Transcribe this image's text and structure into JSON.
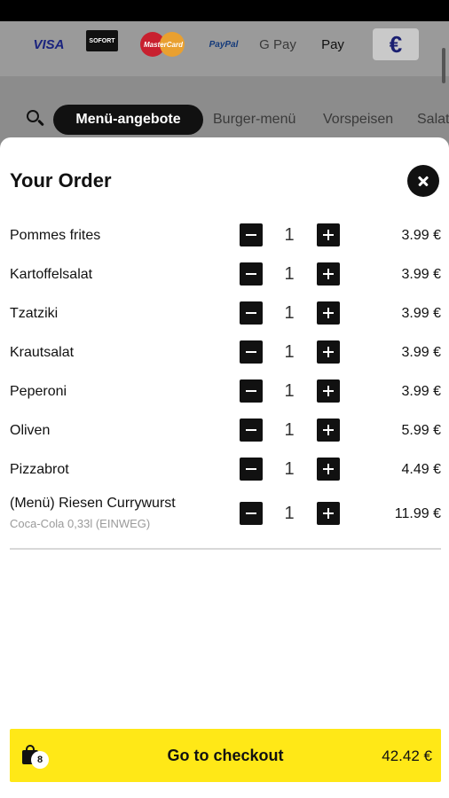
{
  "payment_methods": {
    "visa": "VISA",
    "sofort": "SOFORT",
    "mastercard": "MasterCard",
    "paypal": "PayPal",
    "gpay": "G Pay",
    "applepay": " Pay",
    "euro": "€"
  },
  "nav": {
    "tabs": [
      {
        "label": "Menü-angebote",
        "active": true
      },
      {
        "label": "Burger-menü",
        "active": false
      },
      {
        "label": "Vorspeisen",
        "active": false
      },
      {
        "label": "Salat",
        "active": false
      }
    ]
  },
  "order": {
    "title": "Your Order",
    "items": [
      {
        "name": "Pommes frites",
        "qty": "1",
        "price": "3.99 €"
      },
      {
        "name": "Kartoffelsalat",
        "qty": "1",
        "price": "3.99 €"
      },
      {
        "name": "Tzatziki",
        "qty": "1",
        "price": "3.99 €"
      },
      {
        "name": "Krautsalat",
        "qty": "1",
        "price": "3.99 €"
      },
      {
        "name": "Peperoni",
        "qty": "1",
        "price": "3.99 €"
      },
      {
        "name": "Oliven",
        "qty": "1",
        "price": "5.99 €"
      },
      {
        "name": "Pizzabrot",
        "qty": "1",
        "price": "4.49 €"
      },
      {
        "name": "(Menü) Riesen Currywurst",
        "sub": "Coca-Cola 0,33l (EINWEG)",
        "qty": "1",
        "price": "11.99 €"
      }
    ]
  },
  "checkout": {
    "count": "8",
    "label": "Go to checkout",
    "total": "42.42 €"
  },
  "colors": {
    "accent": "#ffe817",
    "dark": "#111111"
  }
}
